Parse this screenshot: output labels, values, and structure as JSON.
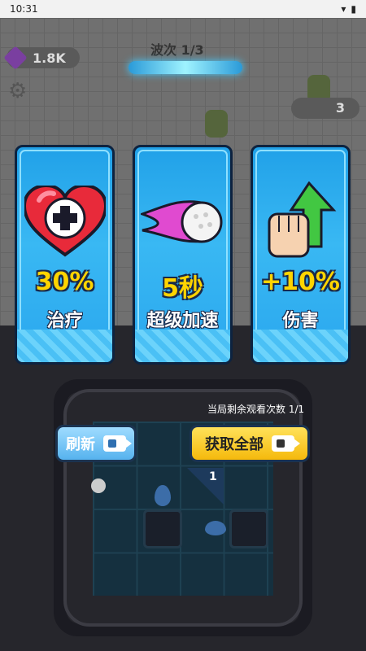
{
  "status_bar": {
    "time": "10:31"
  },
  "hud": {
    "gems": "1.8K",
    "wave_label": "波次 1/3",
    "enemy_count": "3"
  },
  "cards": [
    {
      "value": "30%",
      "label": "治疗",
      "icon": "heart-plus-icon"
    },
    {
      "value": "5秒",
      "label": "超级加速",
      "icon": "fireball-icon"
    },
    {
      "value": "+10%",
      "label": "伤害",
      "icon": "fist-arrow-up-icon"
    }
  ],
  "board": {
    "watch_notice": "当局剩余观看次数 1/1",
    "refresh_label": "刷新",
    "get_all_label": "获取全部",
    "tile_number": "1"
  },
  "colors": {
    "card_blue": "#2aa7ee",
    "value_yellow": "#ffd400",
    "refresh_btn": "#56b2ee",
    "getall_btn": "#f5b90c"
  }
}
